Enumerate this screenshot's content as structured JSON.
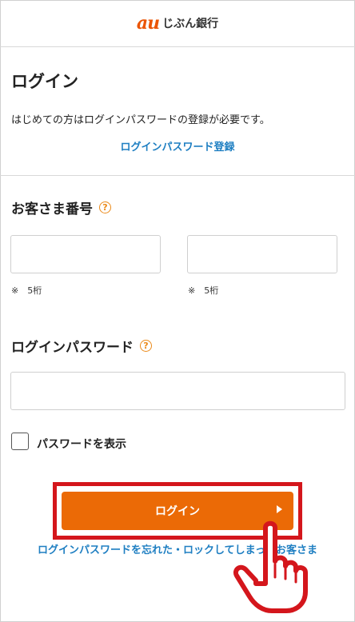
{
  "header": {
    "logo_mark": "au",
    "logo_text": "じぶん銀行"
  },
  "page": {
    "title": "ログイン",
    "intro": "はじめての方はログインパスワードの登録が必要です。",
    "register_link": "ログインパスワード登録"
  },
  "customer_number": {
    "label": "お客さま番号",
    "help": "?",
    "field1_hint": "※　5桁",
    "field2_hint": "※　5桁"
  },
  "password": {
    "label": "ログインパスワード",
    "help": "?",
    "show_password_label": "パスワードを表示"
  },
  "login_button": {
    "label": "ログイン"
  },
  "forgot_link": "ログインパスワードを忘れた・ロックしてしまったお客さま",
  "colors": {
    "accent": "#eb6a06",
    "link": "#1f7fc2",
    "highlight": "#d4161c"
  },
  "icons": [
    "question-icon",
    "arrow-right-icon",
    "pointing-hand-icon"
  ]
}
